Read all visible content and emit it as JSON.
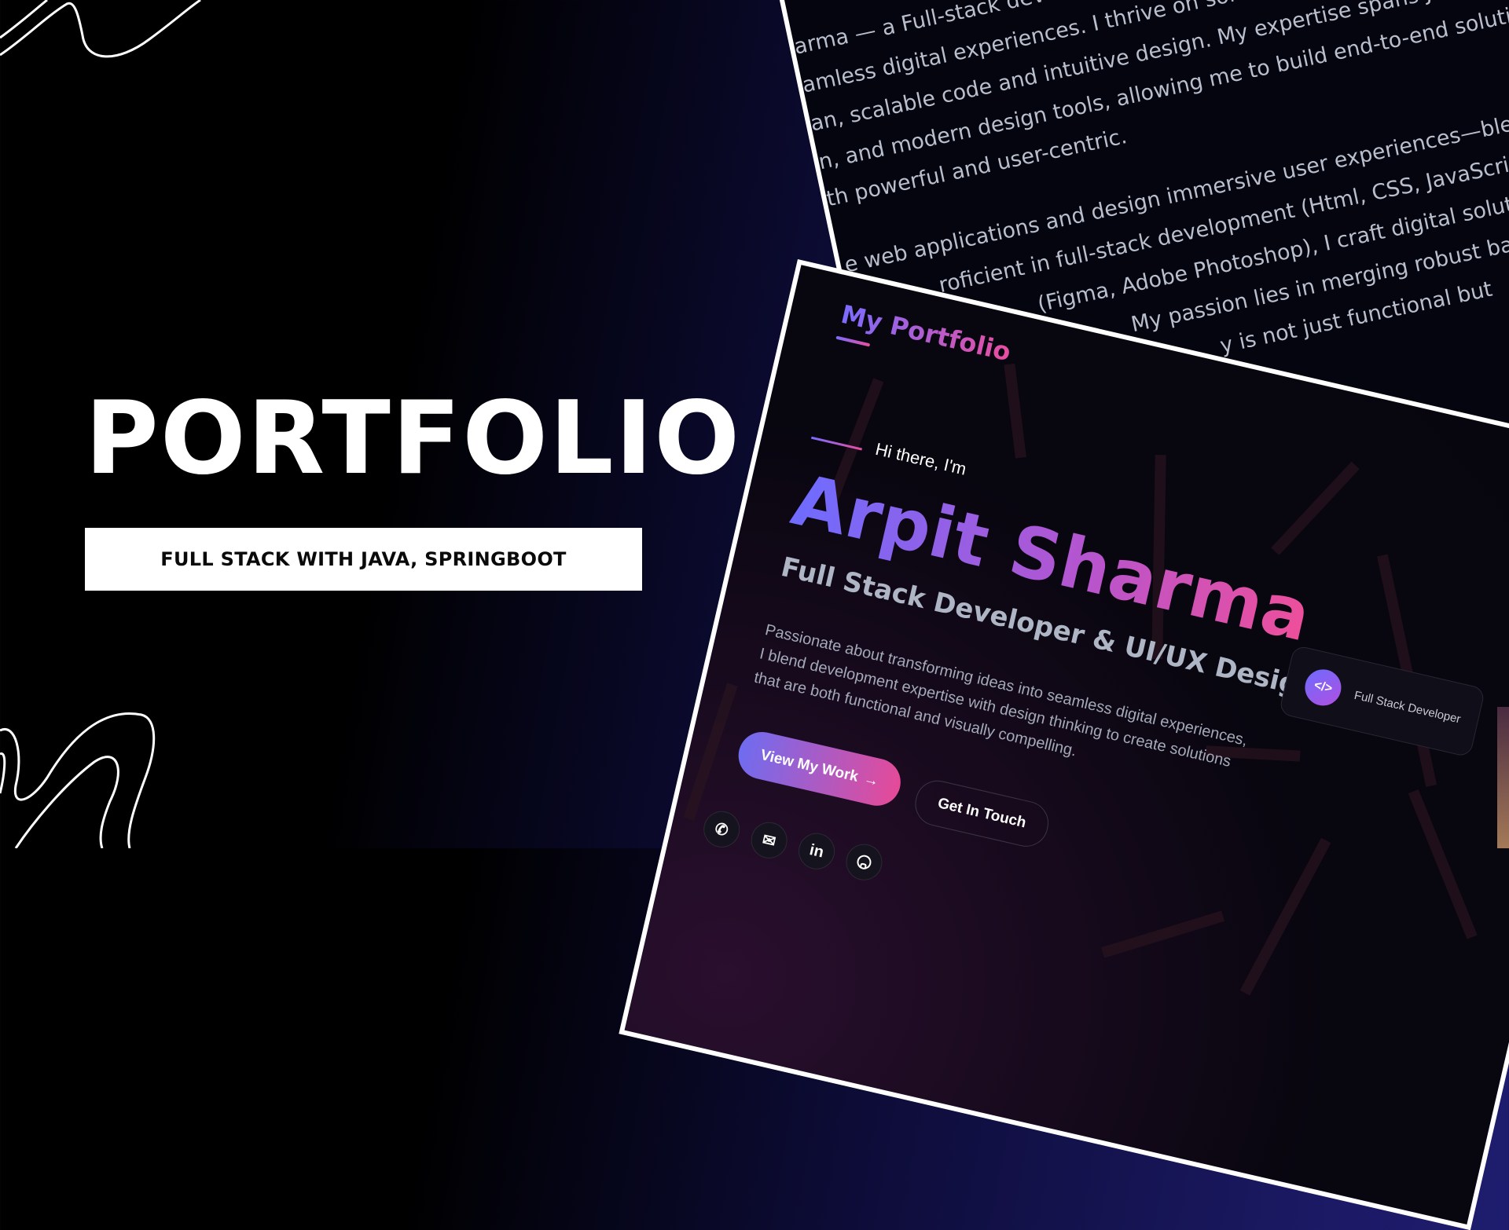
{
  "thumbnail": {
    "title": "PORTFOLIO",
    "tagline": "FULL STACK WITH JAVA, SPRINGBOOT"
  },
  "about_panel": {
    "paragraph1": [
      "arma — a Full-stack developer and",
      "amless digital experiences. I thrive on solving real-world",
      "an, scalable code and intuitive design. My expertise spans JavaScript,",
      "n, and modern design tools, allowing me to build end-to-end solutions",
      "th powerful and user-centric."
    ],
    "paragraph2": [
      "e web applications and design immersive user experiences—blending",
      "roficient in full-stack development (Html, CSS, JavaScript,",
      "(Figma, Adobe Photoshop), I craft digital solutions",
      "My passion lies in merging robust backend",
      "y is not just functional but"
    ]
  },
  "hero": {
    "logo": "My Portfolio",
    "greeting": "Hi there, I'm",
    "name": "Arpit Sharma",
    "role": "Full Stack Developer & UI/UX Designer",
    "bio": "Passionate about transforming ideas into seamless digital experiences, I blend development expertise with design thinking to create solutions that are both functional and visually compelling.",
    "primary_button": "View My Work",
    "primary_button_icon": "arrow-right-icon",
    "secondary_button": "Get In Touch",
    "social_icons": [
      "phone-icon",
      "mail-icon",
      "linkedin-icon",
      "github-icon"
    ],
    "badge": {
      "icon": "code-icon",
      "label": "Full Stack Developer"
    }
  },
  "colors": {
    "accent_start": "#6e6cff",
    "accent_end": "#ee4f9a",
    "background_dark": "#07060f",
    "navy": "#1c1a66"
  }
}
